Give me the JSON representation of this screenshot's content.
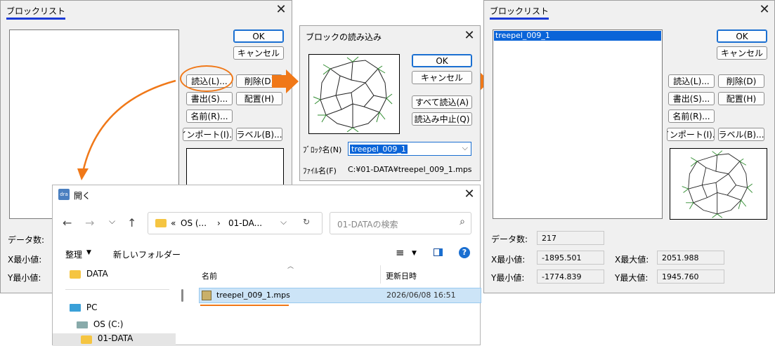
{
  "left_window": {
    "title": "ブロックリスト",
    "ok": "OK",
    "cancel": "キャンセル",
    "read": "読込(L)...",
    "delete": "削除(D)",
    "write": "書出(S)...",
    "place": "配置(H)",
    "rename": "名前(R)...",
    "import": "インポート(I)...",
    "label": "ラベル(B)...",
    "data_count_label": "データ数:",
    "xmin_label": "X最小値:",
    "ymin_label": "Y最小値:"
  },
  "load_dialog": {
    "title": "ブロックの読み込み",
    "ok": "OK",
    "cancel": "キャンセル",
    "read_all": "すべて読込(A)",
    "stop": "読込み中止(Q)",
    "block_name_label": "ﾌﾞﾛｯｸ名(N)",
    "block_name_value": "treepel_009_1",
    "file_name_label": "ﾌｧｲﾙ名(F)",
    "file_name_value": "C:¥01-DATA¥treepel_009_1.mps"
  },
  "right_window": {
    "title": "ブロックリスト",
    "list_items": [
      "treepel_009_1"
    ],
    "ok": "OK",
    "cancel": "キャンセル",
    "read": "読込(L)...",
    "delete": "削除(D)",
    "write": "書出(S)...",
    "place": "配置(H)",
    "rename": "名前(R)...",
    "import": "インポート(I)...",
    "label": "ラベル(B)...",
    "data_count_label": "データ数:",
    "data_count": "217",
    "xmin_label": "X最小値:",
    "xmin": "-1895.501",
    "xmax_label": "X最大値:",
    "xmax": "2051.988",
    "ymin_label": "Y最小値:",
    "ymin": "-1774.839",
    "ymax_label": "Y最大値:",
    "ymax": "1945.760"
  },
  "open_dialog": {
    "app_icon_text": "dra",
    "title": "開く",
    "path_part1": "OS (...",
    "path_part2": "01-DA...",
    "path_prefix": "«",
    "search_placeholder": "01-DATAの検索",
    "organize": "整理",
    "new_folder": "新しいフォルダー",
    "nav_items": [
      "DATA",
      "PC",
      "OS (C:)",
      "01-DATA"
    ],
    "col_name": "名前",
    "col_date": "更新日時",
    "file_name": "treepel_009_1.mps",
    "file_date": "2026/06/08 16:51"
  },
  "colors": {
    "accent_orange": "#f07818",
    "selection_blue": "#0a64d8",
    "title_underline": "#1a3ad6"
  }
}
